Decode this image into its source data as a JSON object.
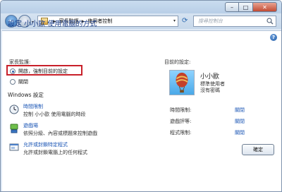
{
  "nav": {
    "breadcrumbs": [
      "家長監護",
      "使用者控制"
    ],
    "search_placeholder": "搜尋控制台"
  },
  "page": {
    "title": "設定 小小歐 使用電腦的方式",
    "parental_controls_label": "家長監護:",
    "options": [
      {
        "label": "開啟，強制目前的設定",
        "checked": true
      },
      {
        "label": "關閉",
        "checked": false
      }
    ],
    "windows_settings_label": "Windows 設定"
  },
  "features": [
    {
      "icon": "clock-icon",
      "link": "時間限制",
      "desc": "控制 小小歐 使用電腦的時段"
    },
    {
      "icon": "game-icon",
      "link": "遊戲場",
      "desc": "依照分級、內容或標題來控制遊戲"
    },
    {
      "icon": "program-icon",
      "link": "允許或封鎖特定程式",
      "desc": "允許或封鎖電腦上的任何程式"
    }
  ],
  "current": {
    "label": "目前的設定:",
    "user_name": "小小歐",
    "user_type": "標準使用者",
    "password": "沒有密碼",
    "settings": [
      {
        "label": "時間限制:",
        "value": "關閉"
      },
      {
        "label": "遊戲評等:",
        "value": "關閉"
      },
      {
        "label": "程式限制:",
        "value": "關閉"
      }
    ]
  },
  "buttons": {
    "ok": "確定"
  },
  "colors": {
    "title_blue": "#1c3f8a",
    "link_blue": "#1a55b5",
    "highlight_red": "#c8202a"
  }
}
